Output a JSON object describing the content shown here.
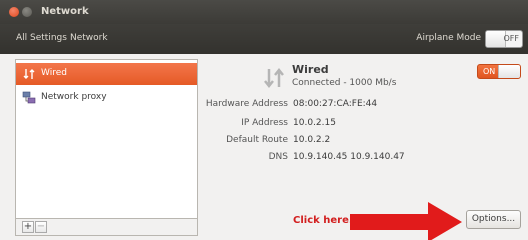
{
  "window": {
    "title": "Network"
  },
  "toolbar": {
    "crumbs": [
      "All Settings",
      "Network"
    ],
    "airplane_mode_label": "Airplane Mode",
    "airplane_toggle": "OFF"
  },
  "sidebar": {
    "items": [
      {
        "label": "Wired",
        "icon": "ethernet-arrows-icon",
        "selected": true
      },
      {
        "label": "Network proxy",
        "icon": "network-proxy-icon",
        "selected": false
      }
    ],
    "add_label": "+",
    "remove_label": "−"
  },
  "detail": {
    "title": "Wired",
    "status": "Connected - 1000 Mb/s",
    "toggle": "ON",
    "properties": [
      {
        "label": "Hardware Address",
        "value": "08:00:27:CA:FE:44"
      },
      {
        "label": "IP Address",
        "value": "10.0.2.15"
      },
      {
        "label": "Default Route",
        "value": "10.0.2.2"
      },
      {
        "label": "DNS",
        "value": "10.9.140.45 10.9.140.47"
      }
    ],
    "options_label": "Options..."
  },
  "annotation": {
    "text": "Click here.",
    "color": "#d21e1e"
  },
  "colors": {
    "accent": "#e55a26"
  }
}
